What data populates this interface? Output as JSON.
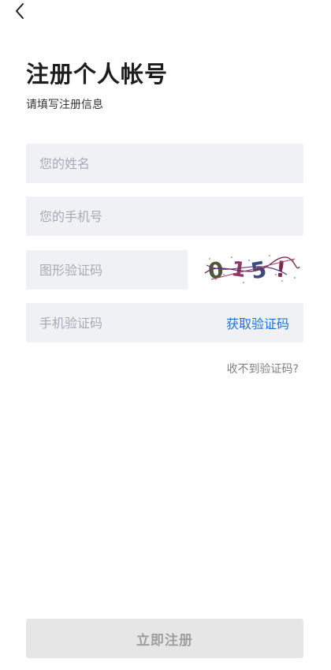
{
  "header": {
    "back_icon": "chevron-left-icon"
  },
  "page": {
    "title": "注册个人帐号",
    "subtitle": "请填写注册信息"
  },
  "form": {
    "name_placeholder": "您的姓名",
    "phone_placeholder": "您的手机号",
    "captcha_placeholder": "图形验证码",
    "captcha_image_text": "015!",
    "sms_placeholder": "手机验证码",
    "get_code_label": "获取验证码",
    "no_code_label": "收不到验证码?"
  },
  "actions": {
    "submit_label": "立即注册"
  },
  "colors": {
    "accent": "#1a73e8",
    "field_bg": "#eff1f5",
    "disabled_button_bg": "#e6e6e6",
    "disabled_button_text": "#9e9e9e"
  }
}
